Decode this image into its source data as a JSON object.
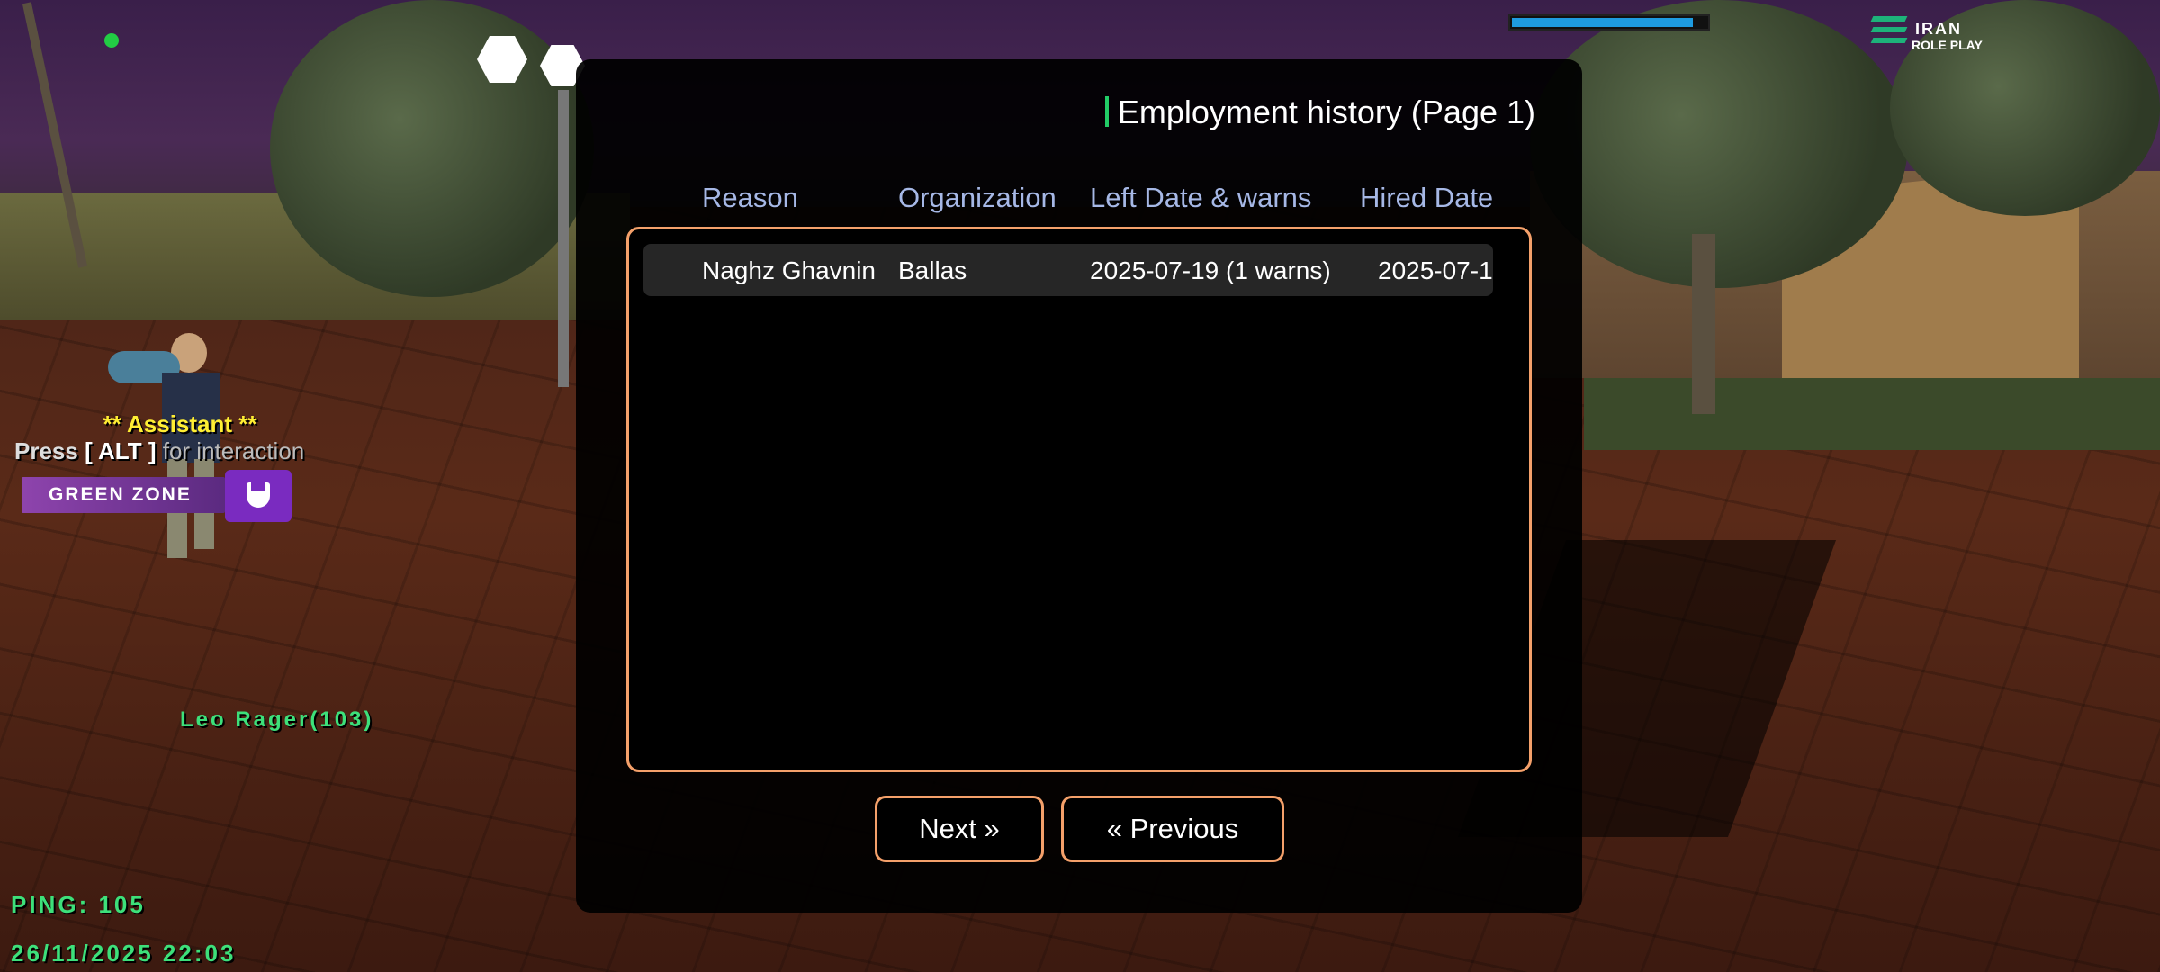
{
  "hud": {
    "assistant_title": "** Assistant **",
    "press_prefix": "Press",
    "press_key": "[ ALT ]",
    "press_suffix": "for interaction",
    "zone_label": "GREEN ZONE",
    "player_name": "Leo Rager(103)",
    "ping": "PING: 105",
    "datetime": "26/11/2025 22:03",
    "health_fraction": 0.95,
    "logo": {
      "line1": "IRAN",
      "line2": "ROLE PLAY"
    },
    "colors": {
      "hud_green": "#3de07a",
      "zone_purple": "#8e44ad",
      "health_blue": "#1e9be0"
    }
  },
  "dialog": {
    "title": "Employment history (Page 1)",
    "columns": [
      "Reason",
      "Organization",
      "Left Date & warns",
      "Hired Date"
    ],
    "rows": [
      {
        "reason": "Naghz Ghavnin",
        "organization": "Ballas",
        "left_date_warns": "2025-07-19 (1 warns)",
        "hired_date": "2025-07-1"
      }
    ],
    "next_label": "Next »",
    "previous_label": "« Previous",
    "colors": {
      "accent_orange": "#f4a06a",
      "header_blue": "#a6b8e6",
      "title_marker": "#22cc66"
    }
  }
}
